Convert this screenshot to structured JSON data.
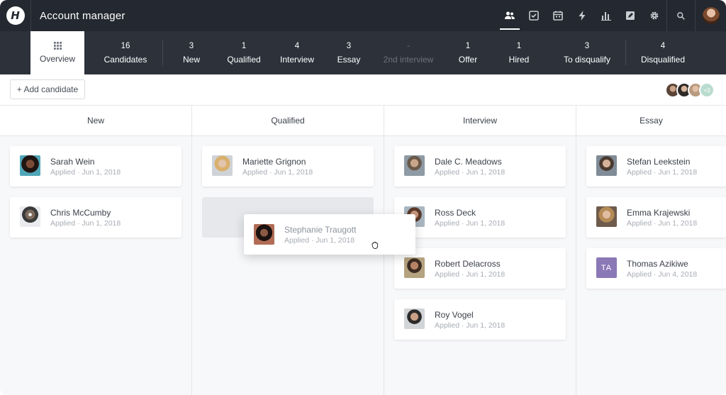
{
  "app": {
    "logo_letter": "H",
    "title": "Account manager"
  },
  "top_nav": {
    "icons": [
      "people-icon",
      "checkbox-icon",
      "calendar-icon",
      "lightning-icon",
      "bar-chart-icon",
      "edit-icon",
      "gear-icon"
    ],
    "active": "people-icon",
    "search_icon": "search-icon"
  },
  "stages": [
    {
      "id": "overview",
      "count": "",
      "label": "Overview"
    },
    {
      "id": "candidates",
      "count": "16",
      "label": "Candidates"
    },
    {
      "id": "new",
      "count": "3",
      "label": "New"
    },
    {
      "id": "qualified",
      "count": "1",
      "label": "Qualified"
    },
    {
      "id": "interview",
      "count": "4",
      "label": "Interview"
    },
    {
      "id": "essay",
      "count": "3",
      "label": "Essay"
    },
    {
      "id": "second-interview",
      "count": "-",
      "label": "2nd interview"
    },
    {
      "id": "offer",
      "count": "1",
      "label": "Offer"
    },
    {
      "id": "hired",
      "count": "1",
      "label": "Hired"
    },
    {
      "id": "to-disqualify",
      "count": "3",
      "label": "To disqualify"
    },
    {
      "id": "disqualified",
      "count": "4",
      "label": "Disqualified"
    }
  ],
  "toolbar": {
    "add_candidate": "+ Add candidate",
    "team_more": "+3"
  },
  "columns": [
    {
      "title": "New",
      "cards": [
        {
          "name": "Sarah Wein",
          "applied": "Applied · Jun 1, 2018"
        },
        {
          "name": "Chris McCumby",
          "applied": "Applied · Jun 1, 2018"
        }
      ]
    },
    {
      "title": "Qualified",
      "cards": [
        {
          "name": "Mariette Grignon",
          "applied": "Applied · Jun 1, 2018"
        }
      ]
    },
    {
      "title": "Interview",
      "cards": [
        {
          "name": "Dale C. Meadows",
          "applied": "Applied · Jun 1, 2018"
        },
        {
          "name": "Ross Deck",
          "applied": "Applied · Jun 1, 2018"
        },
        {
          "name": "Robert Delacross",
          "applied": "Applied · Jun 1, 2018"
        },
        {
          "name": "Roy Vogel",
          "applied": "Applied · Jun 1, 2018"
        }
      ]
    },
    {
      "title": "Essay",
      "cards": [
        {
          "name": "Stefan Leekstein",
          "applied": "Applied · Jun 1, 2018"
        },
        {
          "name": "Emma Krajewski",
          "applied": "Applied · Jun 1, 2018"
        },
        {
          "name": "Thomas Azikiwe",
          "applied": "Applied · Jun 4, 2018",
          "initials": "TA"
        }
      ]
    }
  ],
  "dragging_card": {
    "name": "Stephanie Traugott",
    "applied": "Applied · Jun 1, 2018"
  },
  "colors": {
    "topbar": "#242830",
    "stagebar": "#2c313a",
    "initials_avatar": "#8b78b6"
  }
}
